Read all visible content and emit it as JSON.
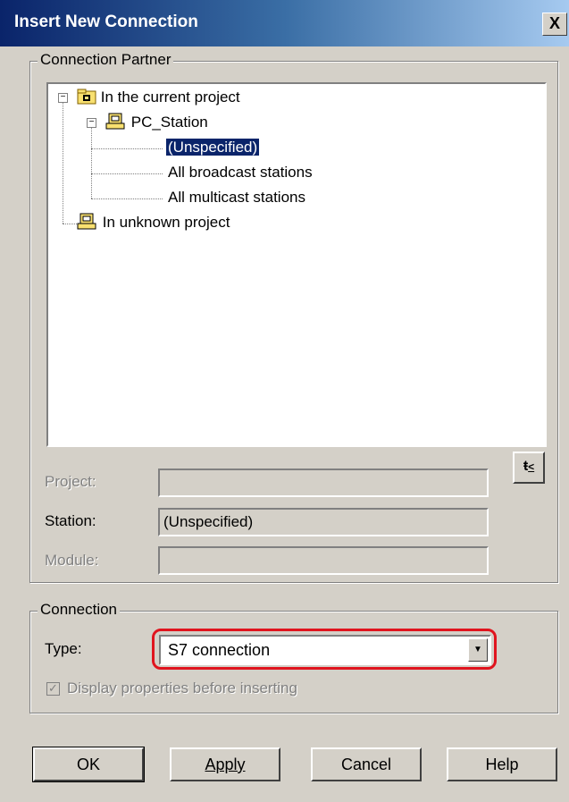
{
  "window": {
    "title": "Insert New Connection",
    "close_glyph": "X"
  },
  "partner_group": {
    "label": "Connection Partner",
    "tree": {
      "root": "In the current project",
      "station": "PC_Station",
      "children": [
        "(Unspecified)",
        "All broadcast stations",
        "All multicast stations"
      ],
      "unknown": "In unknown project",
      "expand_glyph": "−"
    },
    "project_label": "Project:",
    "project_value": "",
    "station_label": "Station:",
    "station_value": "(Unspecified)",
    "module_label": "Module:",
    "module_value": ""
  },
  "connection_group": {
    "label": "Connection",
    "type_label": "Type:",
    "type_value": "S7 connection",
    "display_props_label": "Display properties before inserting",
    "display_props_checked_glyph": "✓"
  },
  "buttons": {
    "ok": "OK",
    "apply": "Apply",
    "cancel": "Cancel",
    "help": "Help"
  },
  "icons": {
    "folder": "project-folder-icon",
    "station": "pc-station-icon",
    "lookup": "lookup-icon"
  },
  "colors": {
    "titlebar_start": "#0a246a",
    "selection": "#0a246a",
    "highlight": "#e0141e"
  }
}
